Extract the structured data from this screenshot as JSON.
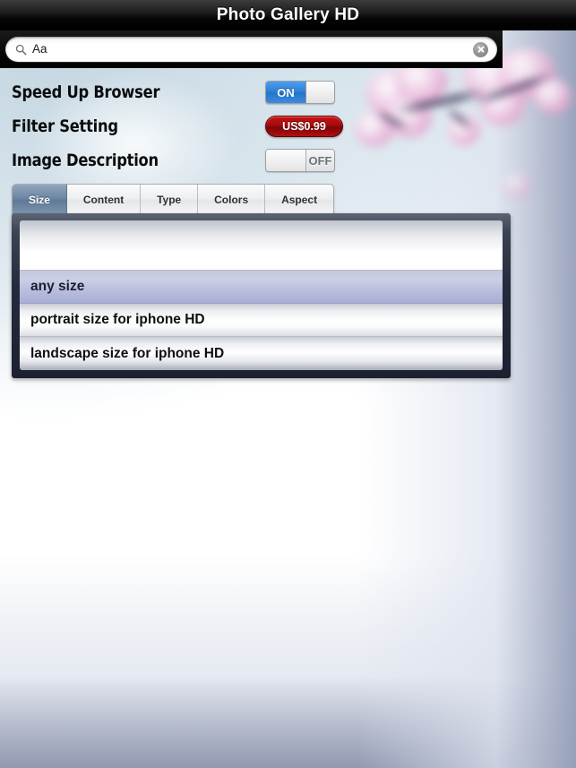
{
  "window": {
    "title": "Photo Gallery HD"
  },
  "search": {
    "icon": "search-icon",
    "value": "Aa",
    "placeholder": "Aa",
    "clear_icon": "clear-circle-icon"
  },
  "settings": {
    "rows": [
      {
        "label": "Speed Up Browser",
        "control": "switch",
        "state": "ON",
        "on_label": "ON",
        "off_label": "OFF"
      },
      {
        "label": "Filter Setting",
        "control": "price-button",
        "price": "US$0.99"
      },
      {
        "label": "Image Description",
        "control": "switch",
        "state": "OFF",
        "on_label": "ON",
        "off_label": "OFF"
      }
    ]
  },
  "tabs": {
    "active_index": 0,
    "items": [
      {
        "label": "Size"
      },
      {
        "label": "Content"
      },
      {
        "label": "Type"
      },
      {
        "label": "Colors"
      },
      {
        "label": "Aspect"
      }
    ]
  },
  "picker": {
    "selected_index": 1,
    "options": [
      {
        "label": ""
      },
      {
        "label": "any size"
      },
      {
        "label": "portrait size for iphone HD"
      },
      {
        "label": "landscape size for iphone HD"
      }
    ]
  },
  "colors": {
    "titlebar": "#000000",
    "accent_switch_on": "#2d7fd6",
    "price_button": "#a20c0e",
    "tab_active": "#6d86a4",
    "picker_selected": "#b9bede",
    "picker_frame": "#242b3c"
  }
}
